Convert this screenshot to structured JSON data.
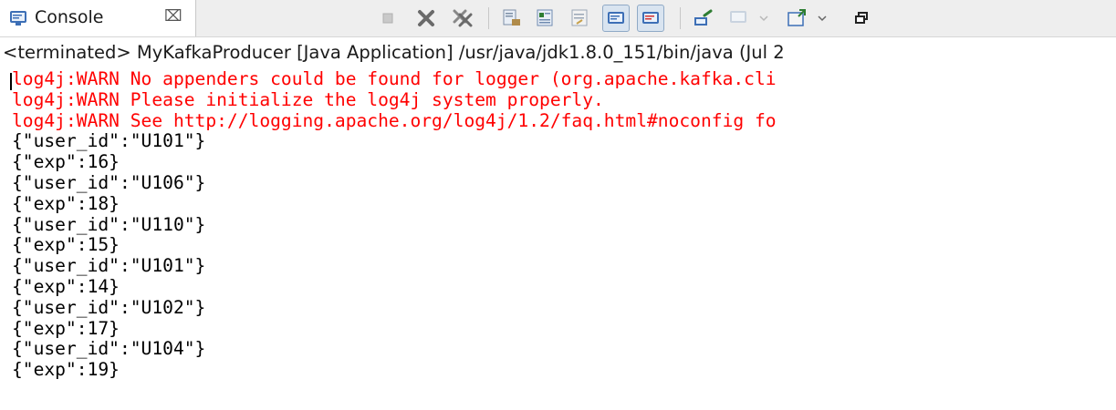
{
  "tab": {
    "label": "Console",
    "close_glyph": "⌧",
    "icon": "console-icon"
  },
  "toolbar": {
    "buttons": [
      {
        "name": "terminate-icon",
        "pressed": false
      },
      {
        "name": "remove-launch-icon",
        "pressed": false
      },
      {
        "name": "remove-all-terminated-icon",
        "pressed": false
      },
      {
        "name": "clear-console-icon",
        "pressed": false
      },
      {
        "name": "scroll-lock-icon",
        "pressed": false
      },
      {
        "name": "word-wrap-icon",
        "pressed": false
      },
      {
        "name": "show-console-on-stdout-icon",
        "pressed": true
      },
      {
        "name": "show-console-on-stderr-icon",
        "pressed": true
      },
      {
        "name": "pin-console-icon",
        "pressed": false
      },
      {
        "name": "display-selected-console-icon",
        "pressed": false
      },
      {
        "name": "open-console-icon",
        "pressed": false
      }
    ]
  },
  "status_line": "<terminated> MyKafkaProducer [Java Application] /usr/java/jdk1.8.0_151/bin/java (Jul 2",
  "colors": {
    "stderr": "#ff0000",
    "stdout": "#000000",
    "pressed_bg": "#d9e4f0"
  },
  "console_lines": [
    {
      "text": "log4j:WARN No appenders could be found for logger (org.apache.kafka.cli",
      "stream": "stderr"
    },
    {
      "text": "log4j:WARN Please initialize the log4j system properly.",
      "stream": "stderr"
    },
    {
      "text": "log4j:WARN See http://logging.apache.org/log4j/1.2/faq.html#noconfig fo",
      "stream": "stderr"
    },
    {
      "text": "{\"user_id\":\"U101\"}",
      "stream": "stdout"
    },
    {
      "text": "{\"exp\":16}",
      "stream": "stdout"
    },
    {
      "text": "{\"user_id\":\"U106\"}",
      "stream": "stdout"
    },
    {
      "text": "{\"exp\":18}",
      "stream": "stdout"
    },
    {
      "text": "{\"user_id\":\"U110\"}",
      "stream": "stdout"
    },
    {
      "text": "{\"exp\":15}",
      "stream": "stdout"
    },
    {
      "text": "{\"user_id\":\"U101\"}",
      "stream": "stdout"
    },
    {
      "text": "{\"exp\":14}",
      "stream": "stdout"
    },
    {
      "text": "{\"user_id\":\"U102\"}",
      "stream": "stdout"
    },
    {
      "text": "{\"exp\":17}",
      "stream": "stdout"
    },
    {
      "text": "{\"user_id\":\"U104\"}",
      "stream": "stdout"
    },
    {
      "text": "{\"exp\":19}",
      "stream": "stdout"
    }
  ]
}
